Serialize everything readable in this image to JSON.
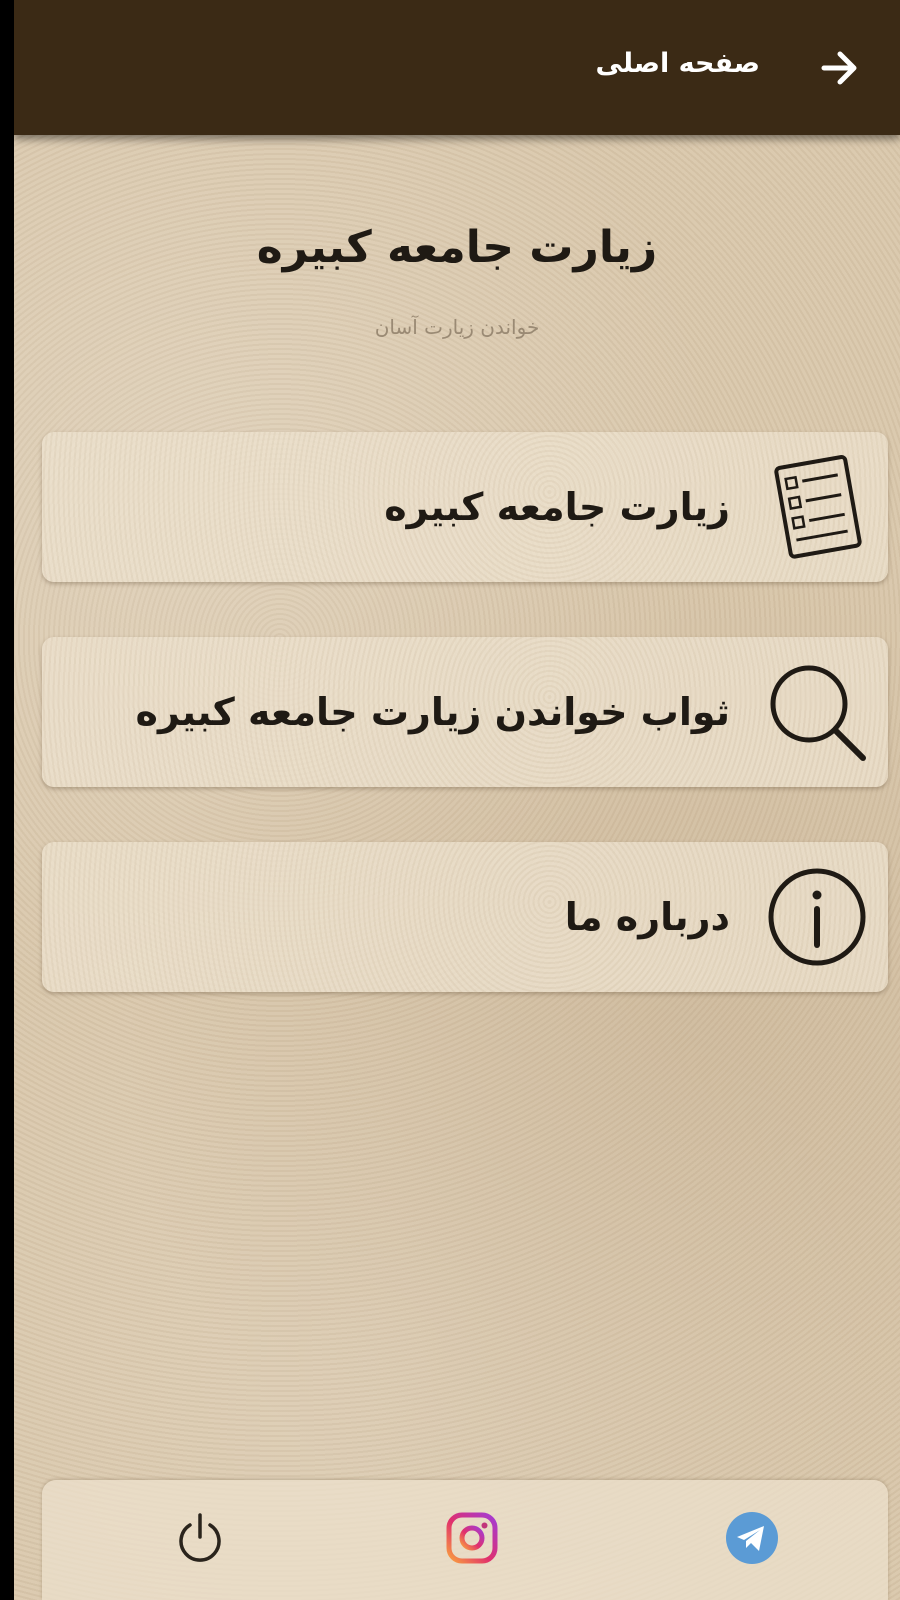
{
  "appbar": {
    "title": "صفحه اصلی",
    "back_icon": "arrow-right-icon"
  },
  "header": {
    "title": "زیارت جامعه کبیره",
    "subtitle": "خواندن زیارت آسان"
  },
  "menu": [
    {
      "label": "زیارت جامعه کبیره",
      "icon": "checklist-document-icon"
    },
    {
      "label": "ثواب خواندن زیارت جامعه کبیره",
      "icon": "search-icon"
    },
    {
      "label": "درباره ما",
      "icon": "info-icon"
    }
  ],
  "bottom_bar": {
    "items": [
      {
        "icon": "power-icon"
      },
      {
        "icon": "instagram-icon"
      },
      {
        "icon": "telegram-icon"
      }
    ]
  },
  "colors": {
    "appbar": "#3b2a15",
    "background": "#d9c7ab",
    "card": "#ece0cc",
    "text": "#1f1a14",
    "instagram": "#d6249f",
    "telegram": "#5b9bd5"
  }
}
